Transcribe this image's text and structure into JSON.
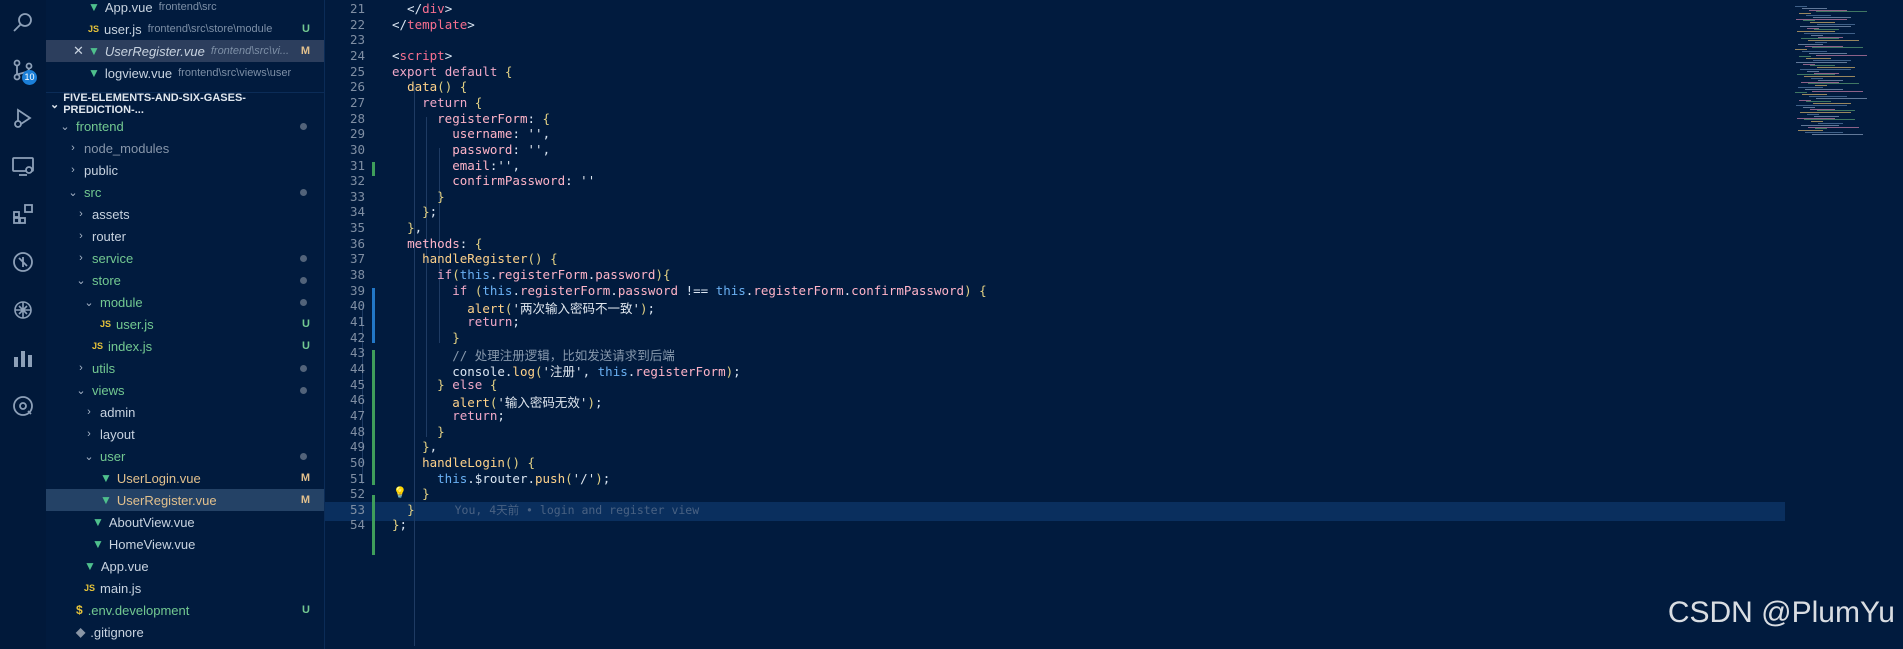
{
  "activity_bar": {
    "items": [
      {
        "name": "search-icon"
      },
      {
        "name": "source-control-icon",
        "badge": "10"
      },
      {
        "name": "run-debug-icon"
      },
      {
        "name": "remote-explorer-icon"
      },
      {
        "name": "extensions-icon"
      },
      {
        "name": "timeline-icon"
      },
      {
        "name": "openai-icon"
      },
      {
        "name": "chart-icon"
      },
      {
        "name": "docker-icon"
      }
    ]
  },
  "open_editors": [
    {
      "name": "App.vue",
      "path": "frontend\\src",
      "status": "",
      "icon": "vue"
    },
    {
      "name": "user.js",
      "path": "frontend\\src\\store\\module",
      "status": "U",
      "icon": "js"
    },
    {
      "name": "UserRegister.vue",
      "path": "frontend\\src\\vi...",
      "status": "M",
      "icon": "vue",
      "active": true
    },
    {
      "name": "logview.vue",
      "path": "frontend\\src\\views\\user",
      "status": "",
      "icon": "vue"
    }
  ],
  "project_title": "FIVE-ELEMENTS-AND-SIX-GASES-PREDICTION-...",
  "tree": [
    {
      "label": "frontend",
      "indent": 0,
      "type": "folder-open",
      "status": "dot",
      "color": "green"
    },
    {
      "label": "node_modules",
      "indent": 1,
      "type": "folder",
      "status": "",
      "color": "gray"
    },
    {
      "label": "public",
      "indent": 1,
      "type": "folder",
      "status": ""
    },
    {
      "label": "src",
      "indent": 1,
      "type": "folder-open",
      "status": "dot",
      "color": "green"
    },
    {
      "label": "assets",
      "indent": 2,
      "type": "folder",
      "status": ""
    },
    {
      "label": "router",
      "indent": 2,
      "type": "folder",
      "status": ""
    },
    {
      "label": "service",
      "indent": 2,
      "type": "folder",
      "status": "dot",
      "color": "green"
    },
    {
      "label": "store",
      "indent": 2,
      "type": "folder-open",
      "status": "dot",
      "color": "green"
    },
    {
      "label": "module",
      "indent": 3,
      "type": "folder-open",
      "status": "dot",
      "color": "green"
    },
    {
      "label": "user.js",
      "indent": 4,
      "type": "js",
      "status": "U",
      "color": "green"
    },
    {
      "label": "index.js",
      "indent": 3,
      "type": "js",
      "status": "U",
      "color": "green"
    },
    {
      "label": "utils",
      "indent": 2,
      "type": "folder",
      "status": "dot",
      "color": "green"
    },
    {
      "label": "views",
      "indent": 2,
      "type": "folder-open",
      "status": "dot",
      "color": "green"
    },
    {
      "label": "admin",
      "indent": 3,
      "type": "folder",
      "status": ""
    },
    {
      "label": "layout",
      "indent": 3,
      "type": "folder",
      "status": ""
    },
    {
      "label": "user",
      "indent": 3,
      "type": "folder-open",
      "status": "dot",
      "color": "green"
    },
    {
      "label": "UserLogin.vue",
      "indent": 4,
      "type": "vue",
      "status": "M",
      "color": "yellow"
    },
    {
      "label": "UserRegister.vue",
      "indent": 4,
      "type": "vue",
      "status": "M",
      "color": "yellow",
      "selected": true
    },
    {
      "label": "AboutView.vue",
      "indent": 3,
      "type": "vue",
      "status": ""
    },
    {
      "label": "HomeView.vue",
      "indent": 3,
      "type": "vue",
      "status": ""
    },
    {
      "label": "App.vue",
      "indent": 2,
      "type": "vue",
      "status": ""
    },
    {
      "label": "main.js",
      "indent": 2,
      "type": "js",
      "status": ""
    },
    {
      "label": ".env.development",
      "indent": 1,
      "type": "env",
      "status": "U",
      "color": "green"
    },
    {
      "label": ".gitignore",
      "indent": 1,
      "type": "git",
      "status": ""
    }
  ],
  "editor": {
    "first_line": 21,
    "lines": [
      "  </div>",
      "</template>",
      "",
      "<script>",
      "export default {",
      "  data() {",
      "    return {",
      "      registerForm: {",
      "        username: '',",
      "        password: '',",
      "        email:'',",
      "        confirmPassword: ''",
      "      }",
      "    };",
      "  },",
      "  methods: {",
      "    handleRegister() {",
      "      if(this.registerForm.password){",
      "        if (this.registerForm.password !== this.registerForm.confirmPassword) {",
      "          alert('两次输入密码不一致');",
      "          return;",
      "        }",
      "        // 处理注册逻辑，比如发送请求到后端",
      "        console.log('注册', this.registerForm);",
      "      } else {",
      "        alert('输入密码无效');",
      "        return;",
      "      }",
      "    },",
      "    handleLogin() {",
      "      this.$router.push('/');",
      "    }",
      "  }",
      "};"
    ],
    "blame_line": 53,
    "blame_text": "You, 4天前 • login and register view"
  },
  "watermark": "CSDN @PlumYu"
}
